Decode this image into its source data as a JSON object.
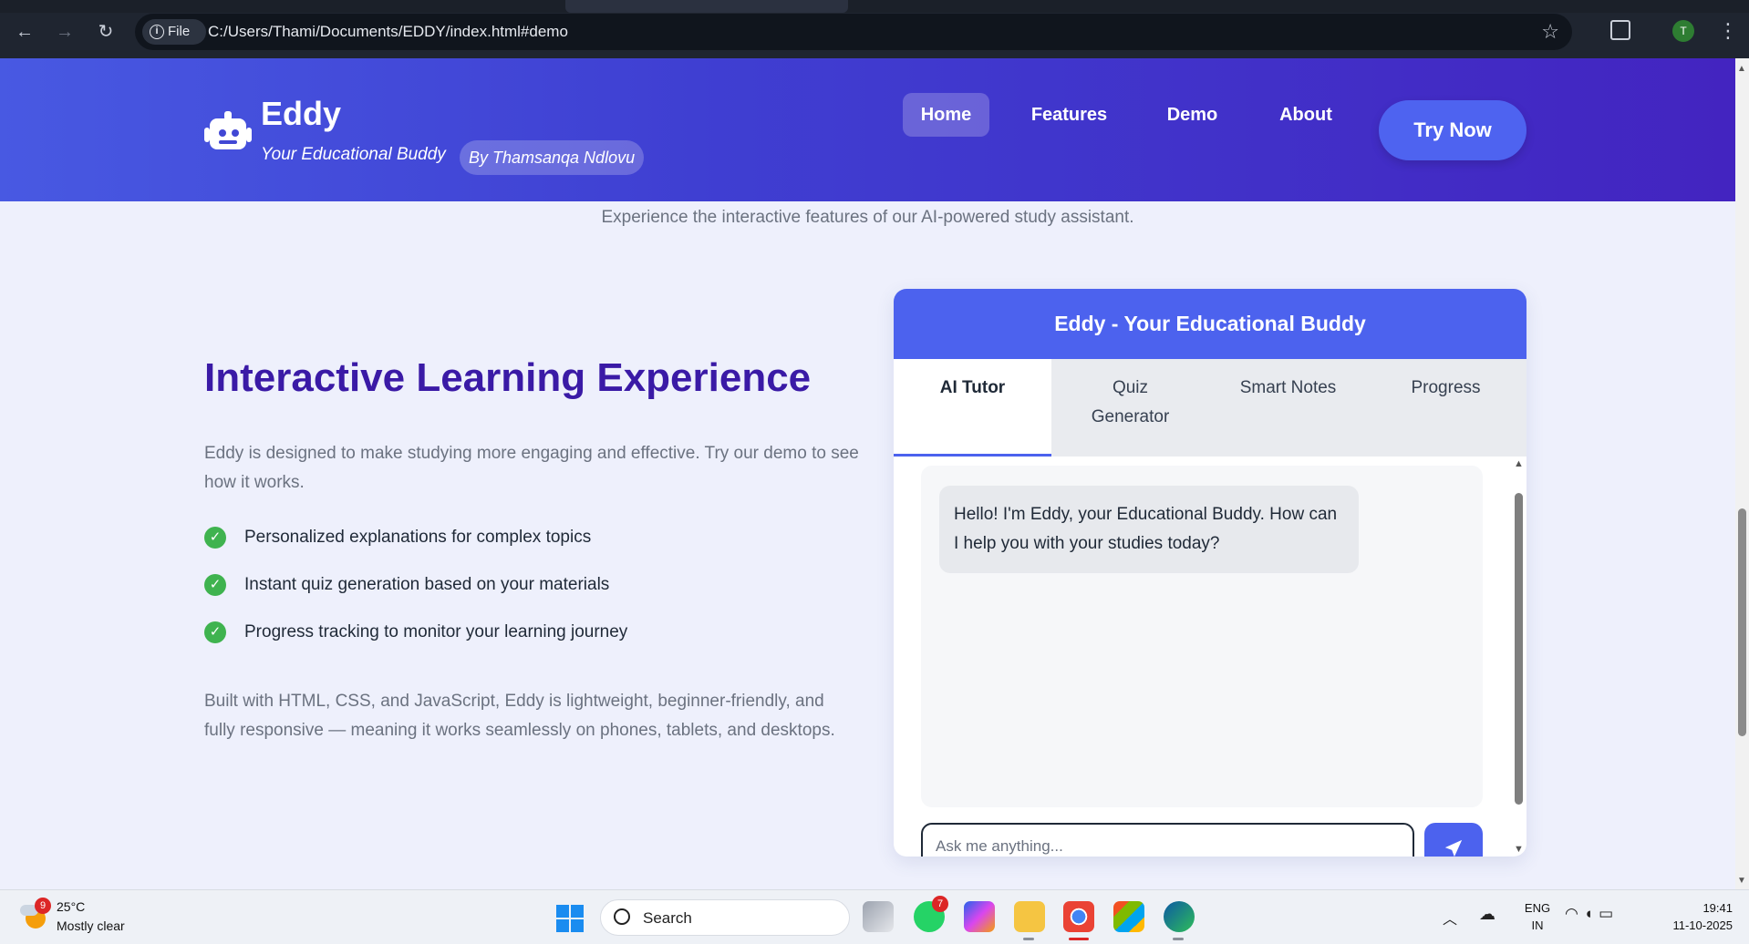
{
  "browser": {
    "file_chip": "File",
    "url": "C:/Users/Thami/Documents/EDDY/index.html#demo",
    "profile_initial": "T"
  },
  "header": {
    "brand": "Eddy",
    "tagline": "Your Educational Buddy",
    "author": "By Thamsanqa Ndlovu",
    "nav": {
      "home": "Home",
      "features": "Features",
      "demo": "Demo",
      "about": "About"
    },
    "cta": "Try Now"
  },
  "demo": {
    "subtitle": "Experience the interactive features of our AI-powered study assistant.",
    "title": "Interactive Learning Experience",
    "description": "Eddy is designed to make studying more engaging and effective. Try our demo to see how it works.",
    "features": [
      "Personalized explanations for complex topics",
      "Instant quiz generation based on your materials",
      "Progress tracking to monitor your learning journey"
    ],
    "built_with": "Built with HTML, CSS, and JavaScript, Eddy is lightweight, beginner-friendly, and fully responsive — meaning it works seamlessly on phones, tablets, and desktops."
  },
  "chat": {
    "title": "Eddy - Your Educational Buddy",
    "tabs": [
      "AI Tutor",
      "Quiz Generator",
      "Smart Notes",
      "Progress"
    ],
    "active_tab": "AI Tutor",
    "bot_message": "Hello! I'm Eddy, your Educational Buddy. How can I help you with your studies today?",
    "input_placeholder": "Ask me anything...",
    "send_icon": "paper-plane-icon"
  },
  "taskbar": {
    "weather_badge": "9",
    "temperature": "25°C",
    "condition": "Mostly clear",
    "search_label": "Search",
    "whatsapp_badge": "7",
    "lang_line1": "ENG",
    "lang_line2": "IN",
    "time": "19:41",
    "date": "11-10-2025"
  },
  "colors": {
    "header_start": "#4859e2",
    "header_end": "#4324c0",
    "accent": "#4c62ee",
    "title": "#3a1aa6",
    "check": "#3fb34f"
  }
}
